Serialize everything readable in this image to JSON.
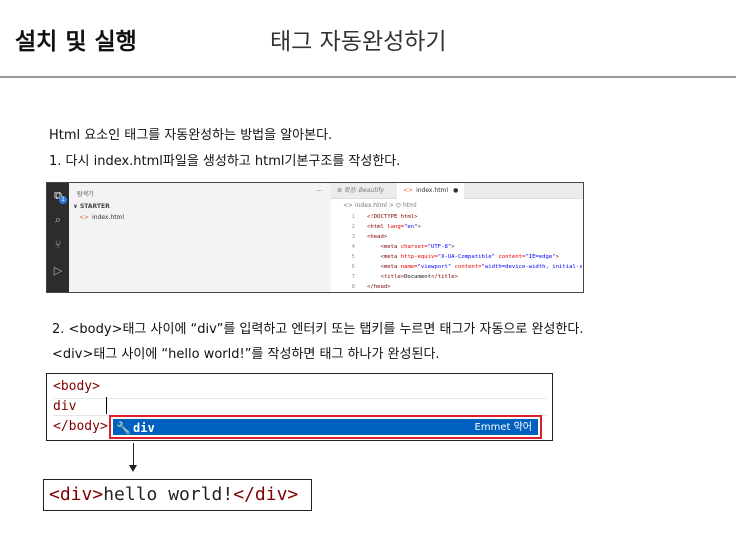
{
  "header": {
    "title": "설치 및 실행",
    "subtitle": "태그 자동완성하기"
  },
  "paragraphs": {
    "intro": "Html 요소인 태그를 자동완성하는 방법을 알아본다.",
    "step1": "1. 다시 index.html파일을 생성하고 html기본구조를 작성한다.",
    "step2": "2. <body>태그 사이에 “div”를 입력하고 엔터키 또는 탭키를 누르면 태그가 자동으로 완성한다.",
    "step2b": "<div>태그 사이에  “hello world!”를 작성하면 태그 하나가 완성된다."
  },
  "vscode": {
    "explorer_title": "탐색기",
    "explorer_more": "···",
    "section": "∨ STARTER",
    "file_tag": "<>",
    "file": "index.html",
    "tab_preview": "≣ 확장: Beautify",
    "tab_active_tag": "<>",
    "tab_active": "index.html",
    "tab_dot": "●",
    "breadcrumb": "<> index.html > ⌬ html",
    "lines": [
      {
        "n": "1",
        "parts": [
          {
            "c": "bracket",
            "t": "<!DOCTYPE html>"
          }
        ]
      },
      {
        "n": "2",
        "parts": [
          {
            "c": "bracket",
            "t": "<html "
          },
          {
            "c": "attr",
            "t": "lang="
          },
          {
            "c": "val",
            "t": "\"en\""
          },
          {
            "c": "bracket",
            "t": ">"
          }
        ]
      },
      {
        "n": "3",
        "parts": [
          {
            "c": "bracket",
            "t": "<head>"
          }
        ]
      },
      {
        "n": "4",
        "parts": [
          {
            "c": "text",
            "t": "    "
          },
          {
            "c": "bracket",
            "t": "<meta "
          },
          {
            "c": "attr",
            "t": "charset="
          },
          {
            "c": "val",
            "t": "\"UTF-8\""
          },
          {
            "c": "bracket",
            "t": ">"
          }
        ]
      },
      {
        "n": "5",
        "parts": [
          {
            "c": "text",
            "t": "    "
          },
          {
            "c": "bracket",
            "t": "<meta "
          },
          {
            "c": "attr",
            "t": "http-equiv="
          },
          {
            "c": "val",
            "t": "\"X-UA-Compatible\" "
          },
          {
            "c": "attr",
            "t": "content="
          },
          {
            "c": "val",
            "t": "\"IE=edge\""
          },
          {
            "c": "bracket",
            "t": ">"
          }
        ]
      },
      {
        "n": "6",
        "parts": [
          {
            "c": "text",
            "t": "    "
          },
          {
            "c": "bracket",
            "t": "<meta "
          },
          {
            "c": "attr",
            "t": "name="
          },
          {
            "c": "val",
            "t": "\"viewport\" "
          },
          {
            "c": "attr",
            "t": "content="
          },
          {
            "c": "val",
            "t": "\"width=device-width, initial-sca"
          }
        ]
      },
      {
        "n": "7",
        "parts": [
          {
            "c": "text",
            "t": "    "
          },
          {
            "c": "bracket",
            "t": "<title>"
          },
          {
            "c": "text",
            "t": "Document"
          },
          {
            "c": "bracket",
            "t": "</title>"
          }
        ]
      },
      {
        "n": "8",
        "parts": [
          {
            "c": "bracket",
            "t": "</head>"
          }
        ]
      }
    ]
  },
  "emmet": {
    "line1": "<body>",
    "line2": "    div",
    "line3": "</body>",
    "suggestion_label": "div",
    "suggestion_detail": "Emmet 약어"
  },
  "result": {
    "open_tag": "<div>",
    "text": "hello world!",
    "close_tag": "</div>"
  },
  "icons": {
    "files": "⧉",
    "search": "⌕",
    "git": "⑂",
    "run": "▷",
    "wrench": "🔧"
  },
  "colors": {
    "suggest_bg": "#0060c0",
    "suggest_border": "#e01e2e",
    "tag": "#800000"
  }
}
